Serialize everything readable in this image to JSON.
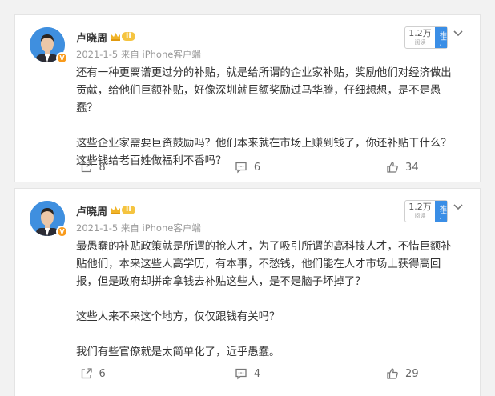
{
  "posts": [
    {
      "author": "卢晓周",
      "level_badge": "II",
      "date": "2021-1-5",
      "source": "来自 iPhone客户端",
      "reads": "1.2万",
      "reads_label": "阅读",
      "promote_label": "推广",
      "paragraphs": [
        "还有一种更离谱更过分的补贴，就是给所谓的企业家补贴，奖励他们对经济做出贡献，给他们巨额补贴，好像深圳就巨额奖励过马华腾，仔细想想，是不是愚蠢？",
        "这些企业家需要巨资鼓励吗？他们本来就在市场上赚到钱了，你还补贴干什么？这些钱给老百姓做福利不香吗？"
      ],
      "shares": "8",
      "comments": "6",
      "likes": "34"
    },
    {
      "author": "卢晓周",
      "level_badge": "II",
      "date": "2021-1-5",
      "source": "来自 iPhone客户端",
      "reads": "1.2万",
      "reads_label": "阅读",
      "promote_label": "推广",
      "paragraphs": [
        "最愚蠢的补贴政策就是所谓的抢人才，为了吸引所谓的高科技人才，不惜巨额补贴他们，本来这些人高学历，有本事，不愁钱，他们能在人才市场上获得高回报，但是政府却拼命拿钱去补贴这些人，是不是脑子坏掉了？",
        "这些人来不来这个地方，仅仅跟钱有关吗？",
        "我们有些官僚就是太简单化了，近乎愚蠢。"
      ],
      "shares": "6",
      "comments": "4",
      "likes": "29"
    }
  ],
  "colors": {
    "page_bg": "#f2f2f2",
    "card_bg": "#ffffff",
    "text": "#333333",
    "meta": "#999999",
    "promo": "#3a8ee6",
    "level": "#f5c440",
    "verified": "#f99b1c"
  },
  "icons": {
    "share": "share-icon",
    "comment": "comment-icon",
    "like": "like-icon",
    "more": "chevron-down-icon",
    "verified": "verified-badge-icon",
    "crown": "crown-icon"
  }
}
